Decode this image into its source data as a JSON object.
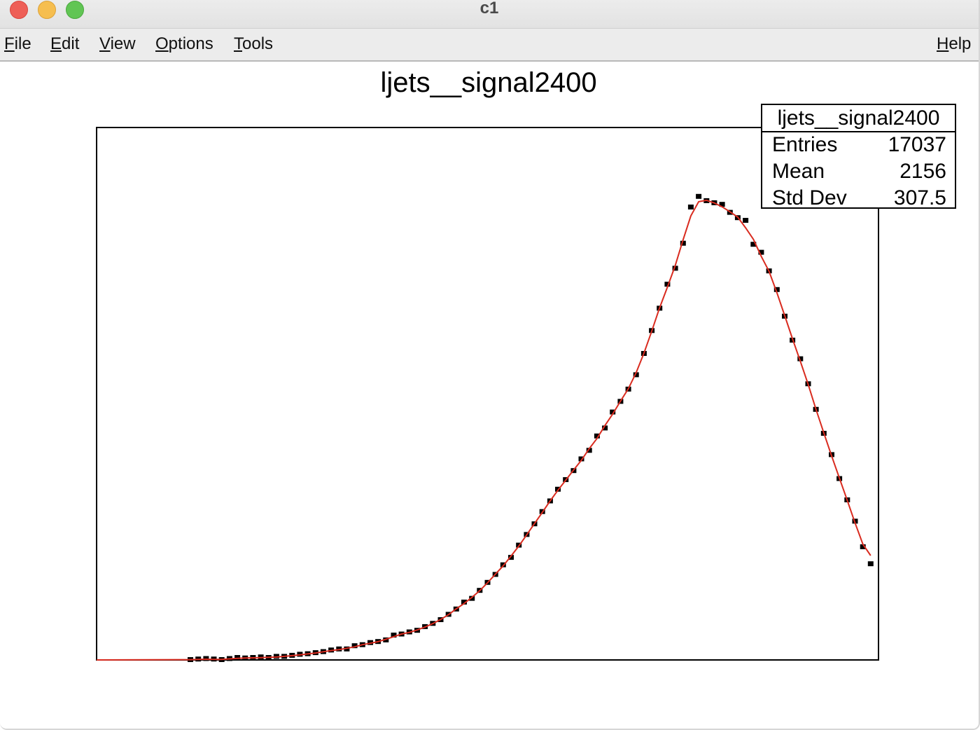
{
  "window": {
    "title": "c1"
  },
  "menu": {
    "file": {
      "key": "F",
      "rest": "ile"
    },
    "edit": {
      "key": "E",
      "rest": "dit"
    },
    "view": {
      "key": "V",
      "rest": "iew"
    },
    "options": {
      "key": "O",
      "rest": "ptions"
    },
    "tools": {
      "key": "T",
      "rest": "ools"
    },
    "help": {
      "key": "H",
      "rest": "elp"
    }
  },
  "stats": {
    "title": "ljets__signal2400",
    "rows": [
      {
        "label": "Entries",
        "value": "17037"
      },
      {
        "label": "Mean",
        "value": "2156"
      },
      {
        "label": "Std Dev",
        "value": "307.5"
      }
    ]
  },
  "chart_data": {
    "type": "scatter",
    "title": "ljets__signal2400",
    "xlabel": "",
    "ylabel": "",
    "xlim": [
      0,
      1
    ],
    "ylim": [
      0,
      1
    ],
    "grid": false,
    "marker_color": "#000000",
    "fit_color": "#d92b1f",
    "series": [
      {
        "x": [
          0.12,
          0.13,
          0.14,
          0.15,
          0.16,
          0.17,
          0.18,
          0.19,
          0.2,
          0.21,
          0.22,
          0.23,
          0.24,
          0.25,
          0.26,
          0.27,
          0.28,
          0.29,
          0.3,
          0.31,
          0.32,
          0.33,
          0.34,
          0.35,
          0.36,
          0.37,
          0.38,
          0.39,
          0.4,
          0.41,
          0.42,
          0.43,
          0.44,
          0.45,
          0.46,
          0.47,
          0.48,
          0.49,
          0.5,
          0.51,
          0.52,
          0.53,
          0.54,
          0.55,
          0.56,
          0.57,
          0.58,
          0.59,
          0.6,
          0.61,
          0.62,
          0.63,
          0.64,
          0.65,
          0.66,
          0.67,
          0.68,
          0.69,
          0.7,
          0.71,
          0.72,
          0.73,
          0.74,
          0.75,
          0.76,
          0.77,
          0.78,
          0.79,
          0.8,
          0.81,
          0.82,
          0.83,
          0.84,
          0.85,
          0.86,
          0.87,
          0.88,
          0.89,
          0.9,
          0.91,
          0.92,
          0.93,
          0.94,
          0.95,
          0.96,
          0.97,
          0.98,
          0.99
        ],
        "y": [
          0.0,
          0.001,
          0.002,
          0.001,
          0.0,
          0.002,
          0.004,
          0.003,
          0.004,
          0.005,
          0.004,
          0.006,
          0.006,
          0.008,
          0.01,
          0.011,
          0.013,
          0.015,
          0.018,
          0.02,
          0.02,
          0.026,
          0.028,
          0.032,
          0.034,
          0.037,
          0.046,
          0.048,
          0.052,
          0.055,
          0.062,
          0.068,
          0.075,
          0.085,
          0.095,
          0.108,
          0.115,
          0.13,
          0.145,
          0.16,
          0.178,
          0.192,
          0.215,
          0.235,
          0.255,
          0.278,
          0.298,
          0.32,
          0.338,
          0.355,
          0.377,
          0.393,
          0.42,
          0.435,
          0.465,
          0.485,
          0.508,
          0.535,
          0.575,
          0.618,
          0.66,
          0.705,
          0.735,
          0.782,
          0.85,
          0.87,
          0.862,
          0.858,
          0.855,
          0.84,
          0.83,
          0.825,
          0.78,
          0.765,
          0.73,
          0.695,
          0.645,
          0.6,
          0.565,
          0.518,
          0.47,
          0.425,
          0.385,
          0.34,
          0.3,
          0.26,
          0.212,
          0.18
        ]
      }
    ]
  }
}
